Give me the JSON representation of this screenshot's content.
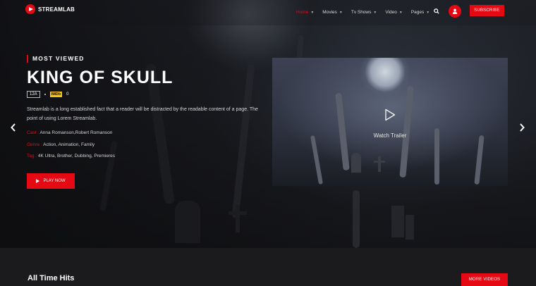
{
  "brand": {
    "name": "STREAMLAB",
    "accent": "#e50914"
  },
  "nav": {
    "items": [
      {
        "label": "Home",
        "active": true
      },
      {
        "label": "Movies",
        "active": false
      },
      {
        "label": "Tv Shows",
        "active": false
      },
      {
        "label": "Video",
        "active": false
      },
      {
        "label": "Pages",
        "active": false
      }
    ],
    "search_icon": "search-icon",
    "user_icon": "user-icon",
    "subscribe_label": "SUBSCRIBE"
  },
  "hero": {
    "eyebrow": "MOST VIEWED",
    "title": "KING OF SKULL",
    "rating": "12A",
    "imdb_label": "IMDb",
    "imdb_score": "0",
    "description": "Streamlab is a long established fact that a reader will be distracted by the readable content of a page. The point of using Lorem Streamlab.",
    "cast_label": "Cast :",
    "cast": "Anna Romanson,Robert Romanson",
    "genre_label": "Genre :",
    "genre": "Action, Animation, Family",
    "tag_label": "Tag :",
    "tags": "4K Ultra, Brother, Dubbing, Premieres",
    "play_label": "PLAY NOW"
  },
  "trailer": {
    "label": "Watch Trailer"
  },
  "slider": {
    "prev_icon": "chevron-left-icon",
    "next_icon": "chevron-right-icon"
  },
  "section": {
    "title": "All Time Hits",
    "more_label": "MORE VIDEOS"
  }
}
